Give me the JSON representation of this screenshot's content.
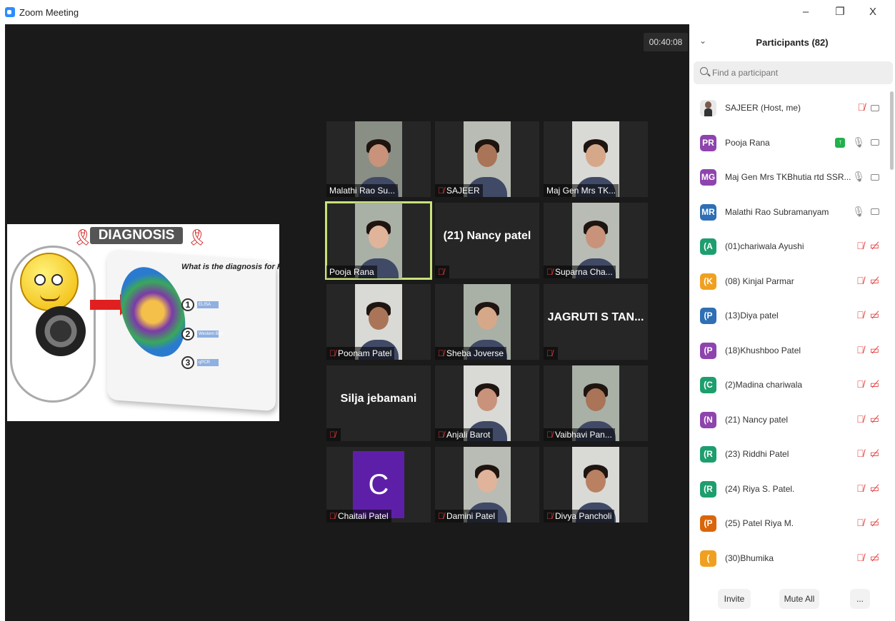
{
  "window": {
    "title": "Zoom Meeting",
    "minimize": "–",
    "restore": "❐",
    "close": "X"
  },
  "meeting": {
    "timer": "00:40:08"
  },
  "share": {
    "heading": "DIAGNOSIS",
    "question": "What is the diagnosis for HIV",
    "steps": [
      {
        "num": "1",
        "label": "ELISA"
      },
      {
        "num": "2",
        "label": "Western Blot"
      },
      {
        "num": "3",
        "label": "qPCR"
      }
    ]
  },
  "tiles": [
    {
      "name": "Malathi Rao Su...",
      "kind": "video",
      "muted": false
    },
    {
      "name": "SAJEER",
      "kind": "video",
      "muted": true
    },
    {
      "name": "Maj Gen Mrs TK...",
      "kind": "video",
      "muted": false
    },
    {
      "name": "Pooja Rana",
      "kind": "video",
      "muted": false,
      "active": true
    },
    {
      "name": "",
      "big": "(21) Nancy patel",
      "kind": "name",
      "muted": true
    },
    {
      "name": "Suparna Cha...",
      "kind": "video",
      "muted": true
    },
    {
      "name": "Poonam Patel",
      "kind": "video",
      "muted": true
    },
    {
      "name": "Sheba Joverse",
      "kind": "video",
      "muted": true
    },
    {
      "name": "",
      "big": "JAGRUTI S TAN...",
      "kind": "name",
      "muted": true
    },
    {
      "name": "",
      "big": "Silja jebamani",
      "kind": "name",
      "muted": true
    },
    {
      "name": "Anjali Barot",
      "kind": "video",
      "muted": true
    },
    {
      "name": "Vaibhavi Pan...",
      "kind": "video",
      "muted": true
    },
    {
      "name": "Chaitali Patel",
      "kind": "avatar",
      "letter": "C",
      "muted": true
    },
    {
      "name": "Damini Patel",
      "kind": "video",
      "muted": true
    },
    {
      "name": "Divya Pancholi",
      "kind": "video",
      "muted": true
    }
  ],
  "panel": {
    "title": "Participants (82)",
    "collapse": "⌄",
    "search_placeholder": "Find a participant",
    "participants": [
      {
        "initials": "",
        "name": "SAJEER (Host, me)",
        "color": "#6b6b6b",
        "photo": true,
        "audio": "muted",
        "video": "on"
      },
      {
        "initials": "PR",
        "name": "Pooja Rana",
        "color": "#8e44ad",
        "audio": "on",
        "video": "on",
        "sharing": true
      },
      {
        "initials": "MG",
        "name": "Maj Gen Mrs TKBhutia rtd  SSR...",
        "color": "#8e44ad",
        "audio": "on",
        "video": "on"
      },
      {
        "initials": "MR",
        "name": "Malathi Rao Subramanyam",
        "color": "#2e6fb5",
        "audio": "on",
        "video": "on"
      },
      {
        "initials": "(A",
        "name": "(01)chariwala Ayushi",
        "color": "#1e9e6e",
        "audio": "muted",
        "video": "off"
      },
      {
        "initials": "(K",
        "name": "(08) Kinjal Parmar",
        "color": "#f0a020",
        "audio": "muted",
        "video": "off"
      },
      {
        "initials": "(P",
        "name": "(13)Diya patel",
        "color": "#2e6fb5",
        "audio": "muted",
        "video": "off"
      },
      {
        "initials": "(P",
        "name": "(18)Khushboo Patel",
        "color": "#8e44ad",
        "audio": "muted",
        "video": "off"
      },
      {
        "initials": "(C",
        "name": "(2)Madina chariwala",
        "color": "#1e9e6e",
        "audio": "muted",
        "video": "off"
      },
      {
        "initials": "(N",
        "name": "(21) Nancy patel",
        "color": "#8e44ad",
        "audio": "muted",
        "video": "off"
      },
      {
        "initials": "(R",
        "name": "(23) Riddhi Patel",
        "color": "#1e9e6e",
        "audio": "muted",
        "video": "off"
      },
      {
        "initials": "(R",
        "name": "(24) Riya S. Patel.",
        "color": "#1e9e6e",
        "audio": "muted",
        "video": "off"
      },
      {
        "initials": "(P",
        "name": "(25) Patel Riya M.",
        "color": "#d9660b",
        "audio": "muted",
        "video": "off"
      },
      {
        "initials": "(",
        "name": "(30)Bhumika",
        "color": "#f0a020",
        "audio": "muted",
        "video": "off"
      }
    ],
    "invite": "Invite",
    "mute_all": "Mute All",
    "more": "..."
  },
  "icons": {
    "mic_off": "mic-off-icon",
    "mic_on": "mic-icon",
    "cam_off": "camera-off-icon",
    "cam_on": "camera-icon"
  }
}
